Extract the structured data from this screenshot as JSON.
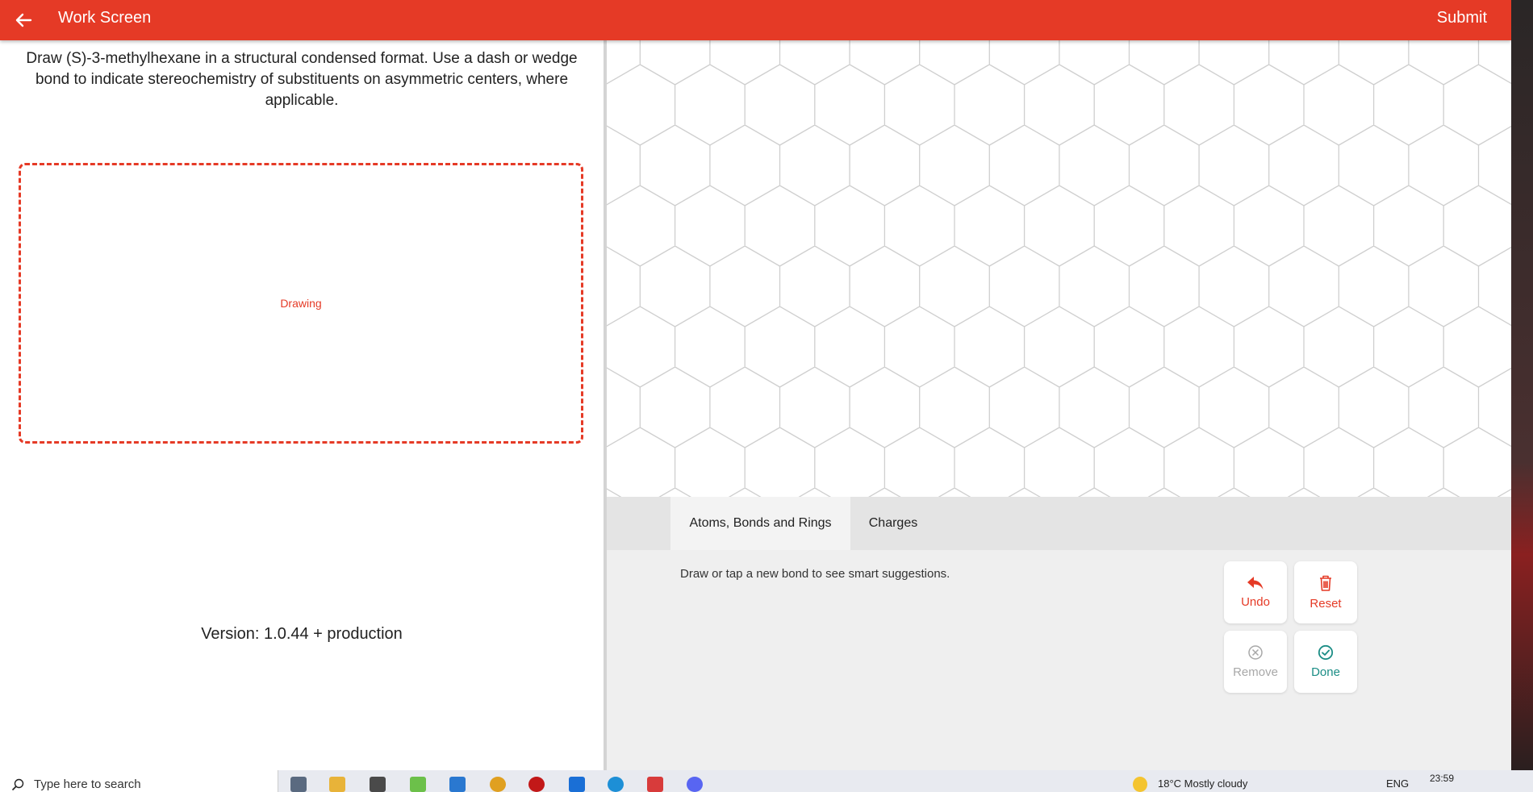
{
  "header": {
    "title": "Work Screen",
    "submit_label": "Submit"
  },
  "question": {
    "text": "Draw (S)-3-methylhexane in a structural condensed format. Use a dash or wedge bond to indicate stereochemistry of substituents on asymmetric centers, where applicable."
  },
  "drawing_box": {
    "label": "Drawing"
  },
  "version": {
    "text": "Version: 1.0.44 +  production"
  },
  "tabs": [
    {
      "label": "Atoms, Bonds and Rings",
      "active": true
    },
    {
      "label": "Charges",
      "active": false
    }
  ],
  "hint": "Draw or tap a new bond to see smart suggestions.",
  "tools": {
    "undo": {
      "label": "Undo",
      "icon": "undo-icon"
    },
    "reset": {
      "label": "Reset",
      "icon": "trash-icon"
    },
    "remove": {
      "label": "Remove",
      "icon": "remove-circle-icon"
    },
    "done": {
      "label": "Done",
      "icon": "check-circle-icon"
    }
  },
  "colors": {
    "accent": "#e53a26",
    "done": "#1b8d85",
    "disabled": "#a8a8a8"
  },
  "taskbar": {
    "search_placeholder": "Type here to search",
    "weather": "18°C  Mostly cloudy",
    "language": "ENG",
    "time": "23:59"
  }
}
